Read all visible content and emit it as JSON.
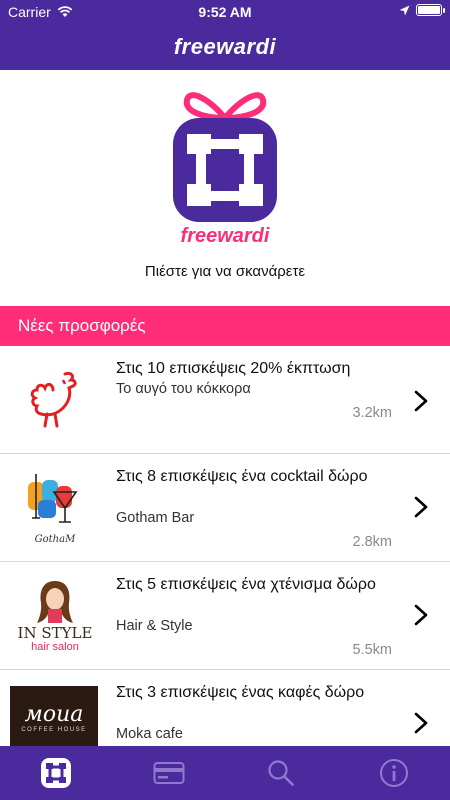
{
  "status_bar": {
    "carrier": "Carrier",
    "time": "9:52 AM",
    "battery_level": 1.0
  },
  "nav": {
    "title": "freewardi"
  },
  "logo": {
    "text": "freewardi",
    "colors": {
      "box": "#4b2a9e",
      "ribbon": "#ff2d78"
    }
  },
  "scan": {
    "label": "Πιέστε για να σκανάρετε"
  },
  "offers": {
    "header": "Νέες προσφορές",
    "items": [
      {
        "title": "Στις 10 επισκέψεις 20% έκπτωση",
        "shop": "Το αυγό του κόκκορα",
        "distance": "3.2km",
        "logo_icon": "rooster-logo"
      },
      {
        "title": "Στις 8 επισκέψεις ένα cocktail δώρο",
        "shop": "Gotham Bar",
        "distance": "2.8km",
        "logo_icon": "gotham-logo",
        "logo_text": "GothaM"
      },
      {
        "title": "Στις 5 επισκέψεις ένα χτένισμα δώρο",
        "shop": "Hair & Style",
        "distance": "5.5km",
        "logo_icon": "in-style-logo",
        "logo_text": "IN STYLE",
        "logo_subtext": "hair salon"
      },
      {
        "title": "Στις 3 επισκέψεις ένας καφές δώρο",
        "shop": "Moka cafe",
        "distance": "",
        "logo_icon": "moka-logo",
        "logo_text": "моиа",
        "logo_subtext": "COFFEE HOUSE"
      }
    ]
  },
  "tab_bar": {
    "tabs": [
      {
        "icon": "freewardi-icon",
        "selected": true
      },
      {
        "icon": "card-icon",
        "selected": false
      },
      {
        "icon": "search-icon",
        "selected": false
      },
      {
        "icon": "info-icon",
        "selected": false
      }
    ]
  },
  "colors": {
    "brand_purple": "#4b2a9e",
    "brand_pink": "#ff2d78"
  }
}
